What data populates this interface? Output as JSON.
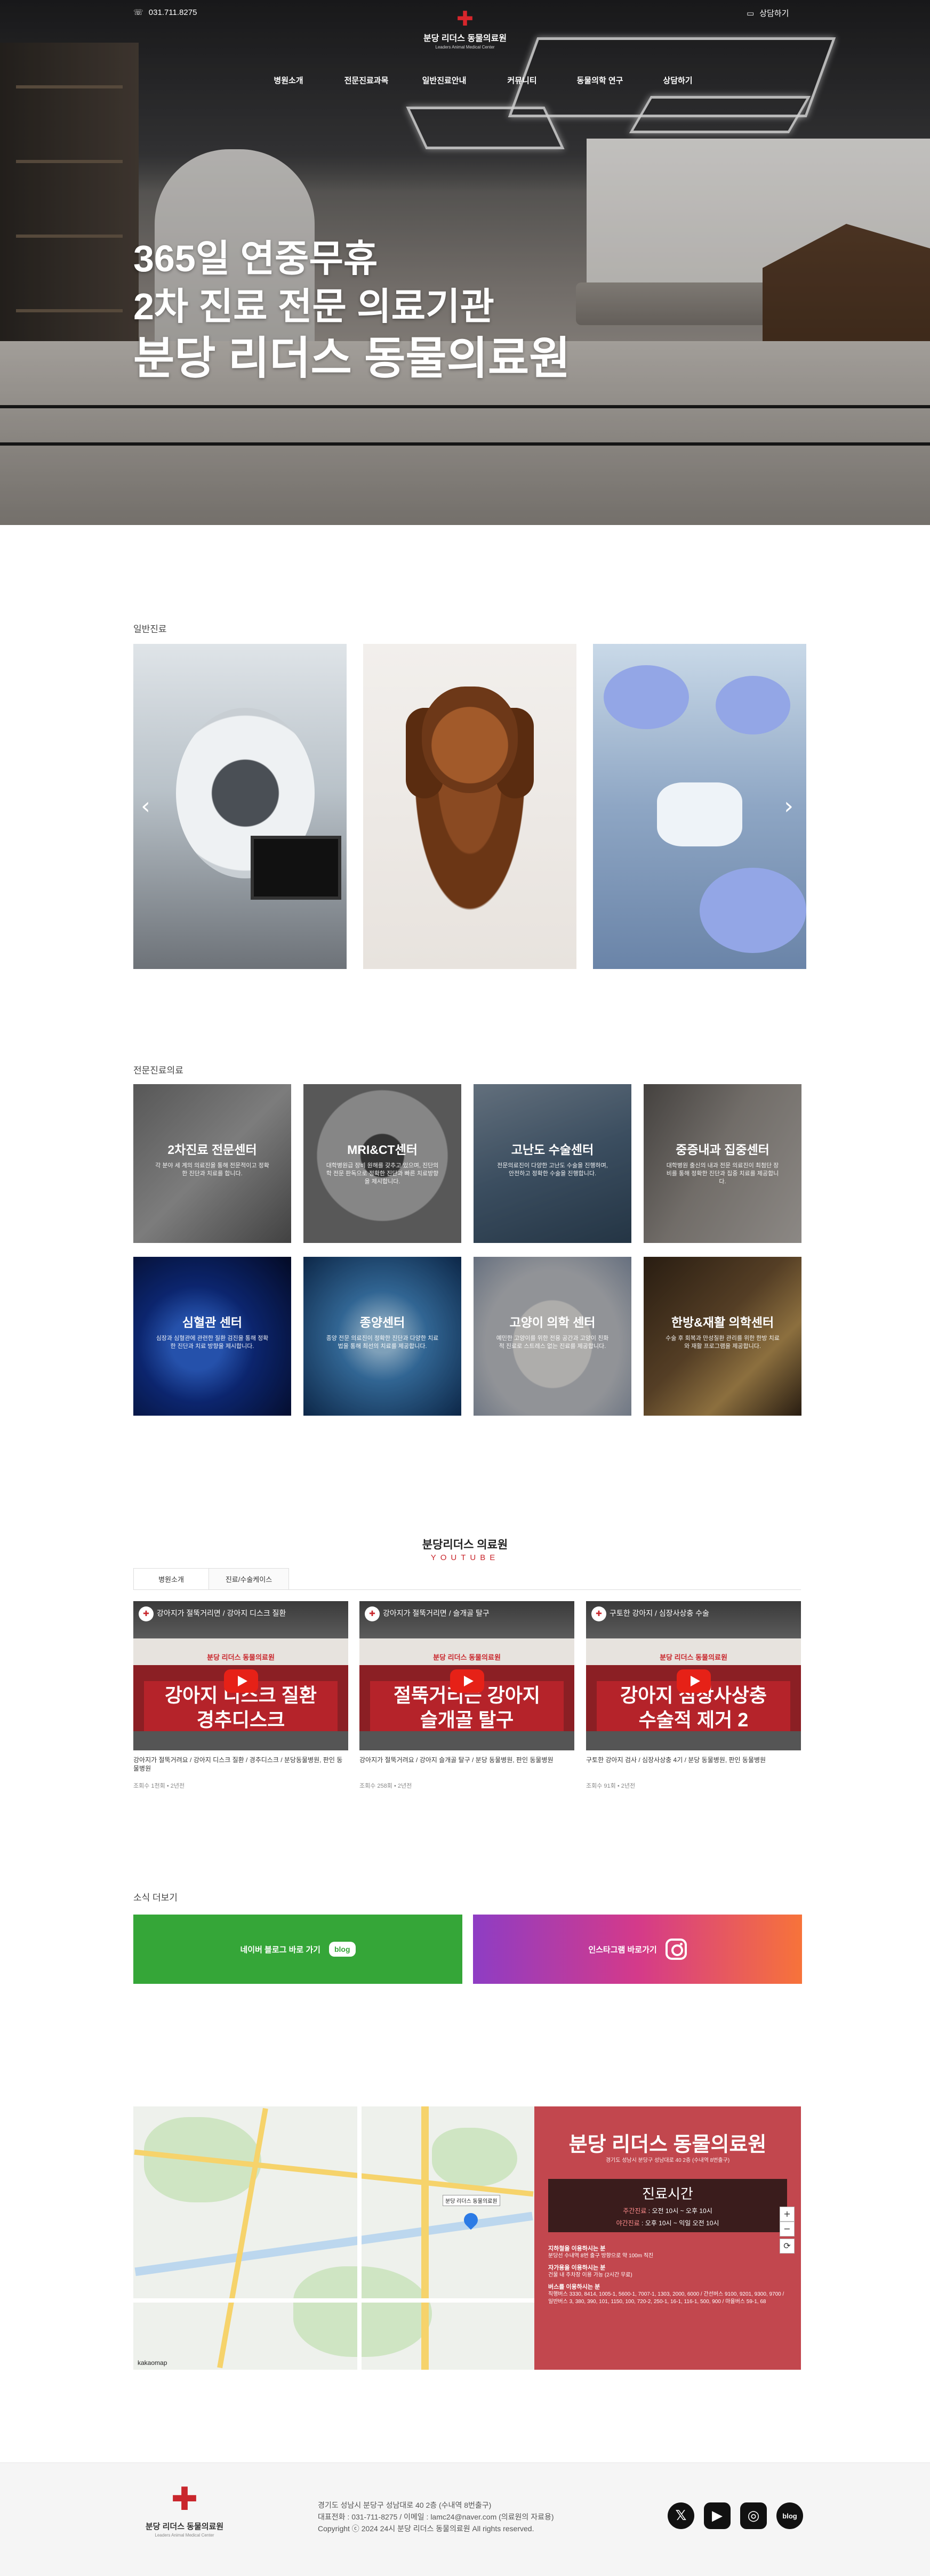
{
  "header": {
    "phone": "031.711.8275",
    "consult_label": "상담하기",
    "brand_cross": "✚",
    "brand_name": "분당 리더스 동물의료원",
    "brand_sub": "Leaders Animal Medical Center"
  },
  "nav": {
    "items": [
      "병원소개",
      "전문진료과목",
      "일반진료안내",
      "커뮤니티",
      "동물의학 연구",
      "상담하기"
    ]
  },
  "hero": {
    "line1": "365일 연중무휴",
    "line2": "2차 진료 전문 의료기관",
    "line3": "분당 리더스 동물의료원"
  },
  "general": {
    "title": "일반진료",
    "prev": "‹",
    "next": "›"
  },
  "specialty": {
    "title": "전문진료의료",
    "cards": [
      {
        "title": "2차진료 전문센터",
        "desc": "각 분야 세 계의 의료진을 통해 전문적이고 정확한 진단과 치료를 합니다."
      },
      {
        "title": "MRI&CT센터",
        "desc": "대학병원급 장비 원해를 갖추고 있으며, 진단의학 전문 판독으로 정확한 진단과 빠른 치료방향을 제시합니다."
      },
      {
        "title": "고난도 수술센터",
        "desc": "전문의료진이 다양한 고난도 수술을 진행하며, 안전하고 정확한 수술을 진행합니다."
      },
      {
        "title": "중증내과 집중센터",
        "desc": "대학병원 출신의 내과 전문 의료진이 최첨단 장비를 통해 정확한 진단과 집중 치료를 제공합니다."
      },
      {
        "title": "심혈관 센터",
        "desc": "심장과 심혈관에 관련한 질환 검진을 통해 정확한 진단과 치료 방향을 제시합니다."
      },
      {
        "title": "종양센터",
        "desc": "종양 전문 의료진이 정확한 진단과 다양한 치료법을 통해 최선의 치료를 제공합니다."
      },
      {
        "title": "고양이 의학 센터",
        "desc": "예민한 고양이를 위한 전용 공간과 고양이 친화적 진료로 스트레스 없는 진료를 제공합니다."
      },
      {
        "title": "한방&재활 의학센터",
        "desc": "수술 후 회복과 만성질환 관리를 위한 한방 치료와 재활 프로그램을 제공합니다."
      }
    ]
  },
  "youtube": {
    "title": "분당리더스 의료원",
    "sub": "YOUTUBE",
    "tabs": [
      "병원소개",
      "진료/수술케이스"
    ],
    "videos": [
      {
        "top": "강아지가 절뚝거리면 / 강아지 디스크 질환",
        "band": "분당 리더스 동물의료원",
        "big": "강아지 디스크 질환\n경추디스크",
        "caption": "강아지가 절뚝거려요 / 강아지 디스크 질환 / 경추디스크 / 분당동물병원, 판인 동물병원",
        "meta": "조회수 1천회 • 2년전"
      },
      {
        "top": "강아지가 절뚝거리면 / 슬개골 탈구",
        "band": "분당 리더스 동물의료원",
        "big": "절뚝거리는 강아지\n슬개골 탈구",
        "caption": "강아지가 절뚝거려요 / 강아지 슬개골 탈구 / 분당 동물병원, 판인 동물병원",
        "meta": "조회수 258회 • 2년전"
      },
      {
        "top": "구토한 강아지 / 심장사상충 수술",
        "band": "분당 리더스 동물의료원",
        "big": "강아지 심장사상충\n수술적 제거 2",
        "caption": "구토한 강아지 검사 / 심장사상충 4기 / 분당 동물병원, 판인 동물병원",
        "meta": "조회수 91회 • 2년전"
      }
    ]
  },
  "news": {
    "title": "소식 더보기",
    "naver_label": "네이버 블로그 바로 가기",
    "naver_badge": "blog",
    "insta_label": "인스타그램 바로가기"
  },
  "location": {
    "hospital_name": "분당 리더스 동물의료원",
    "address": "경기도 성남시 분당구 성남대로 40 2층 (수내역 8번출구)",
    "hours_title": "진료시간",
    "weekday_label": "주간진료",
    "weekday_hours": "오전 10시 ~ 오후 10시",
    "night_label": "야간진료",
    "night_hours": "오후 10시 ~ 익일 오전 10시",
    "directions": [
      {
        "title": "지하철을 이용하시는 분",
        "text": "분당선 수내역 8번 출구 방향으로 약 100m 직진"
      },
      {
        "title": "자가용을 이용하시는 분",
        "text": "건물 내 주차장 이용 가능 (2시간 무료)"
      },
      {
        "title": "버스를 이용하시는 분",
        "text": "직행버스 3330, 8414, 1005-1, 5600-1, 7007-1, 1303, 2000, 6000 / 간선버스 9100, 9201, 9300, 9700 / 일반버스 3, 380, 390, 101, 1150, 100, 720-2, 250-1, 16-1, 116-1, 500, 900 / 마을버스 59-1, 68"
      }
    ],
    "map_brand": "kakaomap",
    "pin_label": "분당 리더스 동물의료원",
    "zoom_in": "+",
    "zoom_out": "−",
    "reload": "⟳"
  },
  "footer": {
    "cross": "✚",
    "name": "분당 리더스 동물의료원",
    "sub": "Leaders Animal Medical Center",
    "line1": "경기도 성남시 분당구 성남대로 40 2층 (수내역 8번출구)",
    "line2": "대표전화 : 031-711-8275 / 이메일 : lamc24@naver.com (의료원의 자료용)",
    "line3": "Copyright ⓒ 2024 24시 분당 리더스 동물의료원 All rights reserved.",
    "icons": [
      "𝕏",
      "▶",
      "◎",
      "blog"
    ]
  },
  "colors": {
    "brand_red": "#c9262c",
    "naver_green": "#35a638",
    "info_panel": "#c2474e"
  }
}
